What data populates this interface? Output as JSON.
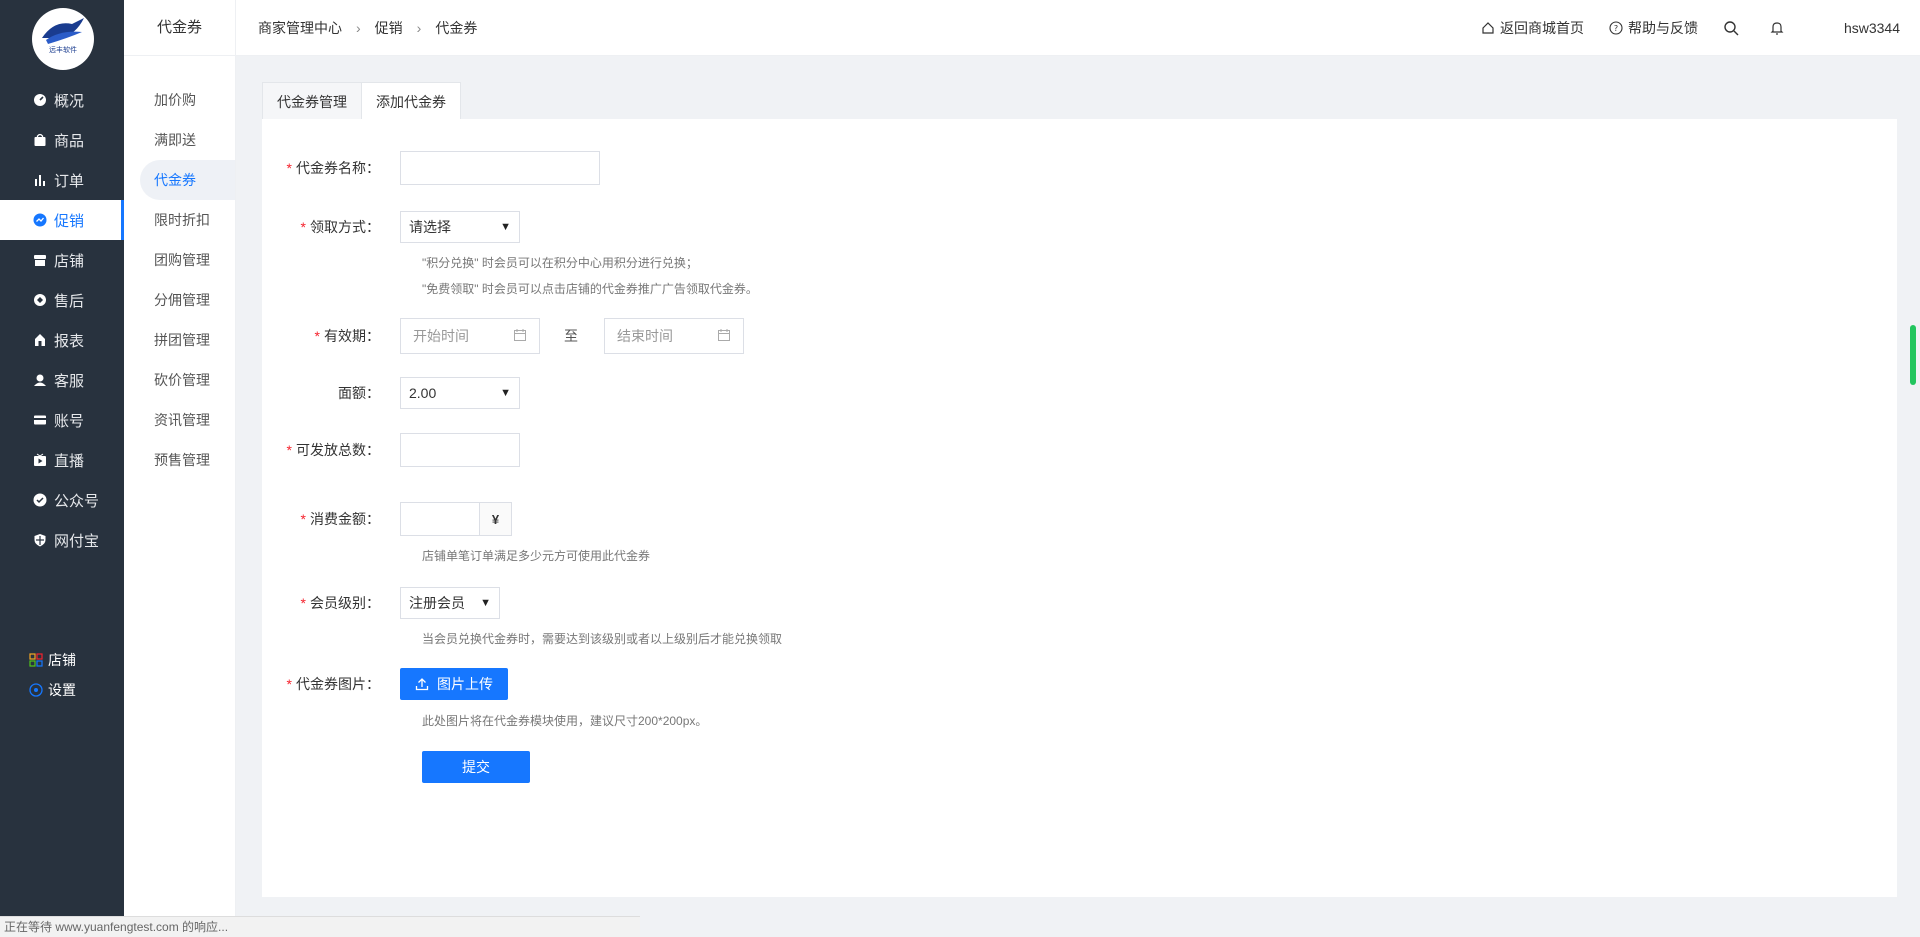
{
  "brand": {
    "logo_text": "远丰软件"
  },
  "sidebar": {
    "items": [
      {
        "label": "概况",
        "icon": "dashboard-icon"
      },
      {
        "label": "商品",
        "icon": "bag-icon"
      },
      {
        "label": "订单",
        "icon": "bar-chart-icon"
      },
      {
        "label": "促销",
        "icon": "promotion-icon"
      },
      {
        "label": "店铺",
        "icon": "store-icon"
      },
      {
        "label": "售后",
        "icon": "service-icon"
      },
      {
        "label": "报表",
        "icon": "report-icon"
      },
      {
        "label": "客服",
        "icon": "support-icon"
      },
      {
        "label": "账号",
        "icon": "card-icon"
      },
      {
        "label": "直播",
        "icon": "live-icon"
      },
      {
        "label": "公众号",
        "icon": "badge-icon"
      },
      {
        "label": "网付宝",
        "icon": "shield-icon"
      }
    ],
    "active_index": 3,
    "bottom": [
      {
        "label": "店铺",
        "icon": "grid-icon"
      },
      {
        "label": "设置",
        "icon": "settings-icon"
      }
    ]
  },
  "subnav": {
    "title": "代金券",
    "items": [
      "加价购",
      "满即送",
      "代金券",
      "限时折扣",
      "团购管理",
      "分佣管理",
      "拼团管理",
      "砍价管理",
      "资讯管理",
      "预售管理"
    ],
    "active_index": 2
  },
  "header": {
    "breadcrumb": [
      "商家管理中心",
      "促销",
      "代金券"
    ],
    "home_link": "返回商城首页",
    "help_link": "帮助与反馈",
    "username": "hsw3344"
  },
  "tabs": [
    "代金券管理",
    "添加代金券"
  ],
  "active_tab": 1,
  "form": {
    "name_label": "代金券名称：",
    "name_value": "",
    "method_label": "领取方式：",
    "method_value": "请选择",
    "method_hint1": "\"积分兑换\" 时会员可以在积分中心用积分进行兑换；",
    "method_hint2": "\"免费领取\" 时会员可以点击店铺的代金券推广广告领取代金券。",
    "validity_label": "有效期：",
    "start_placeholder": "开始时间",
    "to_text": "至",
    "end_placeholder": "结束时间",
    "face_label": "面额：",
    "face_value": "2.00",
    "total_label": "可发放总数：",
    "total_value": "",
    "spend_label": "消费金额：",
    "spend_value": "",
    "currency": "¥",
    "spend_hint": "店铺单笔订单满足多少元方可使用此代金券",
    "level_label": "会员级别：",
    "level_value": "注册会员",
    "level_hint": "当会员兑换代金券时，需要达到该级别或者以上级别后才能兑换领取",
    "image_label": "代金券图片：",
    "upload_label": "图片上传",
    "image_hint": "此处图片将在代金券模块使用，建议尺寸200*200px。",
    "submit_label": "提交"
  },
  "statusbar": {
    "text": "正在等待 www.yuanfengtest.com 的响应..."
  },
  "colors": {
    "sidebar_bg": "#28323e",
    "accent": "#1677ff",
    "required": "#f5222d"
  }
}
